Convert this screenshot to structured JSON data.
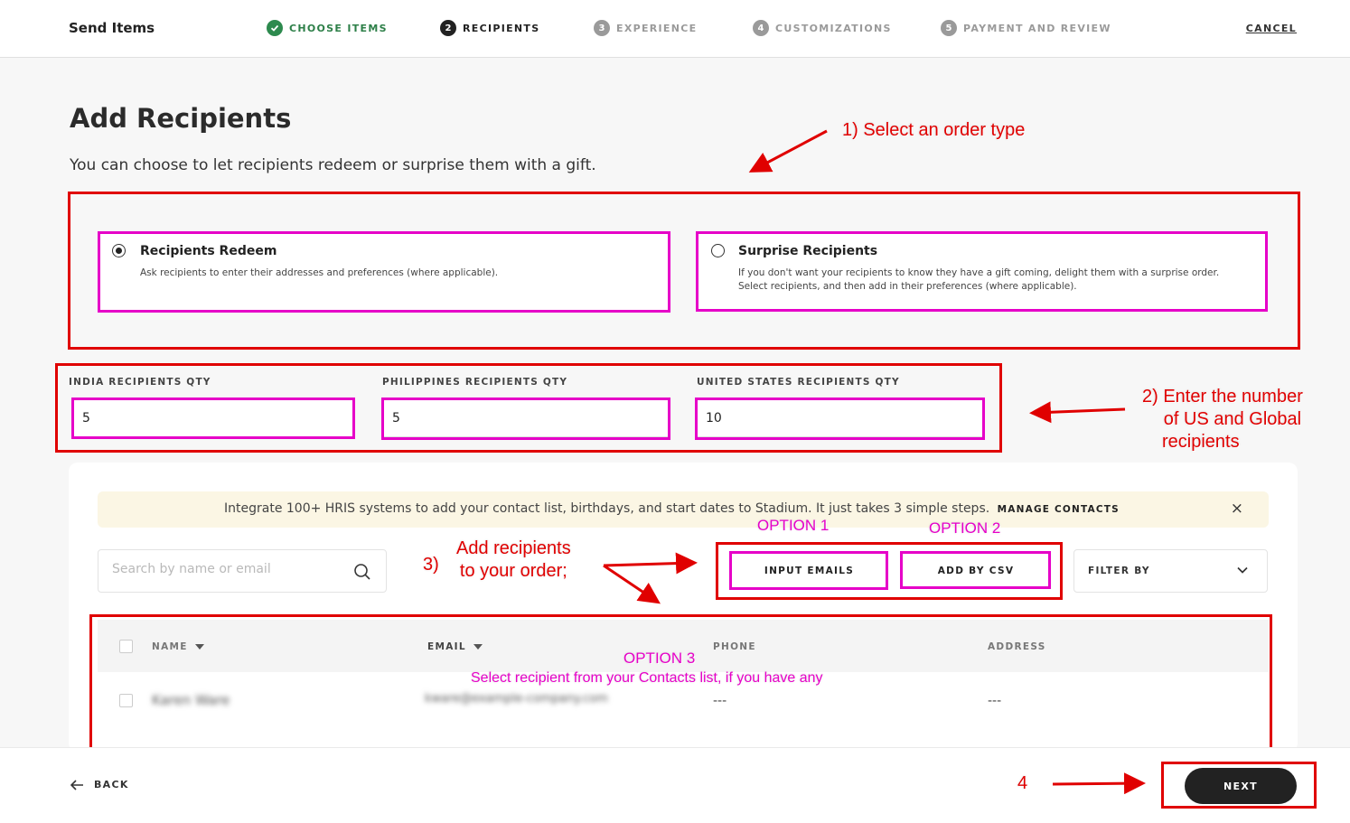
{
  "header": {
    "brand": "Send Items",
    "steps": [
      {
        "num": "✓",
        "label": "CHOOSE ITEMS"
      },
      {
        "num": "2",
        "label": "RECIPIENTS"
      },
      {
        "num": "3",
        "label": "EXPERIENCE"
      },
      {
        "num": "4",
        "label": "CUSTOMIZATIONS"
      },
      {
        "num": "5",
        "label": "PAYMENT AND REVIEW"
      }
    ],
    "cancel_label": "CANCEL"
  },
  "main": {
    "title": "Add Recipients",
    "subtitle": "You can choose to let recipients redeem or surprise them with a gift.",
    "order_types": [
      {
        "title": "Recipients Redeem",
        "description": "Ask recipients to enter their addresses and preferences (where applicable).",
        "selected": true
      },
      {
        "title": "Surprise Recipients",
        "description_line1": "If you don't want your recipients to know they have a gift coming, delight them with a surprise order.",
        "description_line2": "Select recipients, and then add in their preferences (where applicable).",
        "selected": false
      }
    ],
    "quantities": [
      {
        "label": "INDIA RECIPIENTS QTY",
        "value": "5"
      },
      {
        "label": "PHILIPPINES RECIPIENTS QTY",
        "value": "5"
      },
      {
        "label": "UNITED STATES RECIPIENTS QTY",
        "value": "10"
      }
    ],
    "banner": {
      "text": "Integrate 100+ HRIS systems to add your contact list, birthdays, and start dates to Stadium. It just takes 3 simple steps.",
      "link": "MANAGE CONTACTS",
      "close": "×"
    },
    "search": {
      "placeholder": "Search by name or email"
    },
    "buttons": {
      "input_emails": "INPUT EMAILS",
      "add_by_csv": "ADD BY CSV"
    },
    "filter": {
      "label": "FILTER BY"
    },
    "table": {
      "columns": [
        "NAME",
        "EMAIL",
        "PHONE",
        "ADDRESS"
      ],
      "rows": [
        {
          "name": "Karen Ware",
          "email": "kware@example-company.com",
          "phone": "---",
          "address": "---"
        }
      ]
    }
  },
  "footer": {
    "back_label": "BACK",
    "next_label": "NEXT"
  },
  "annotations": {
    "step1": "1)  Select an order type",
    "step2_line1": "2) Enter the number",
    "step2_line2": "of US and Global",
    "step2_line3": "recipients",
    "step3_num": "3)",
    "step3_line1": "Add recipients",
    "step3_line2": "to your order;",
    "option1": "OPTION 1",
    "option2": "OPTION 2",
    "option3": "OPTION 3",
    "option3_desc": "Select recipient from your Contacts list, if you have any",
    "step4": "4"
  },
  "colors": {
    "annotation_red": "#e00000",
    "annotation_magenta": "#e600c8",
    "done_green": "#2d8a4e",
    "primary_dark": "#222222",
    "banner_bg": "#fbf6e4"
  }
}
